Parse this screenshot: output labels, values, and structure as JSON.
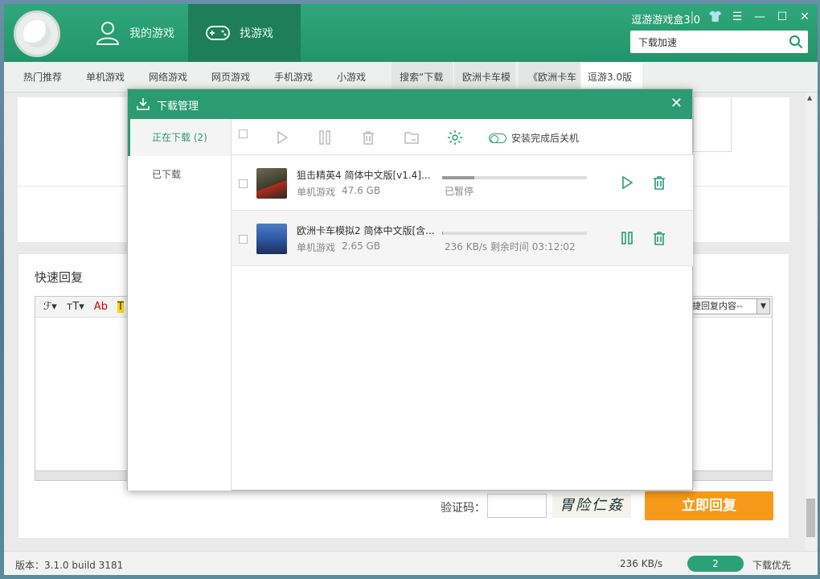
{
  "app": {
    "brand": "逗游游戏盒3.0",
    "tabs": [
      {
        "label": "我的游戏"
      },
      {
        "label": "找游戏"
      }
    ],
    "search_value": "下载加速"
  },
  "nav": {
    "items": [
      "热门推荐",
      "单机游戏",
      "网络游戏",
      "网页游戏",
      "手机游戏",
      "小游戏",
      "搜索“下载",
      "欧洲卡车模",
      "《欧洲卡车",
      "逗游3.0版"
    ]
  },
  "page": {
    "quick_reply_title": "快速回复",
    "editor_tools": [
      "ℱ▾",
      "ᴛT▾",
      "Ab",
      "T"
    ],
    "quick_select": "捷回复内容--",
    "captcha_label": "验证码：",
    "captcha_text": "胃险仁姦",
    "reply_button": "立即回复"
  },
  "status": {
    "version": "版本：3.1.0 build 3181",
    "speed": "236 KB/s",
    "count": "2",
    "priority": "下载优先"
  },
  "dialog": {
    "title": "下载管理",
    "sidebar": [
      {
        "label": "正在下载 (2)"
      },
      {
        "label": "已下载"
      }
    ],
    "shutdown_label": "安装完成后关机",
    "downloads": [
      {
        "name": "狙击精英4  简体中文版[v1.4]...",
        "category": "单机游戏",
        "size": "47.6 GB",
        "progress": 0.22,
        "status": "已暂停",
        "state": "paused"
      },
      {
        "name": "欧洲卡车模拟2  简体中文版[含...",
        "category": "单机游戏",
        "size": "2.65 GB",
        "progress": 0.005,
        "status": "236 KB/s  剩余时间 03:12:02",
        "state": "downloading"
      }
    ]
  },
  "colors": {
    "accent": "#2a9b72",
    "reply": "#f79a19"
  }
}
